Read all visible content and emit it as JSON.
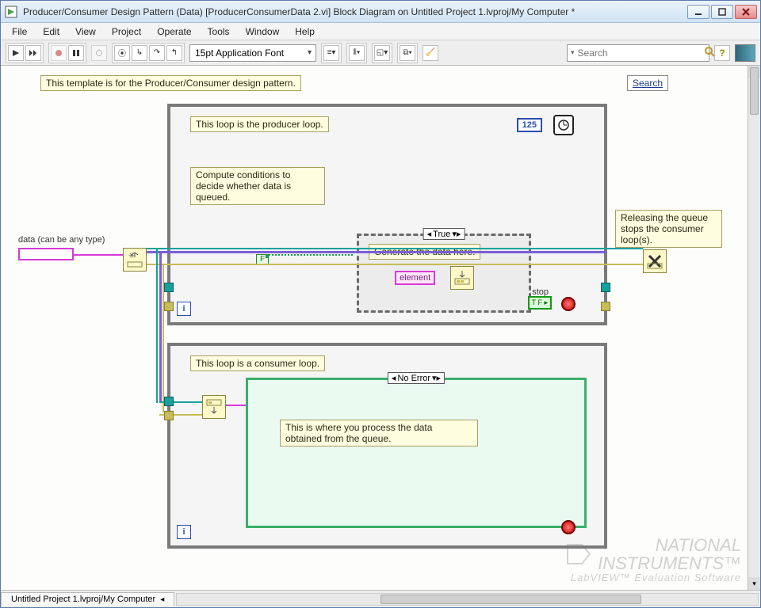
{
  "window": {
    "title": "Producer/Consumer Design Pattern (Data) [ProducerConsumerData 2.vi] Block Diagram on Untitled Project 1.lvproj/My Computer *"
  },
  "menu": [
    "File",
    "Edit",
    "View",
    "Project",
    "Operate",
    "Tools",
    "Window",
    "Help"
  ],
  "toolbar": {
    "font": "15pt Application Font",
    "search_placeholder": "Search"
  },
  "comments": {
    "template": "This template is for the Producer/Consumer design pattern.",
    "search_link": "Search",
    "producer_loop": "This loop is the producer loop.",
    "compute_cond": "Compute conditions to\ndecide whether data is\nqueued.",
    "generate": "Generate the data here.",
    "release": "Releasing the queue\nstops the consumer\nloop(s).",
    "consumer_loop": "This loop is a consumer loop.",
    "process": "This is where you process the data\nobtained from the queue."
  },
  "labels": {
    "data_any": "data (can be any type)",
    "element": "element",
    "stop": "stop",
    "case_true": "True",
    "case_noerr": "No Error"
  },
  "numbers": {
    "timer_ms": "125"
  },
  "footer": {
    "project_tab": "Untitled Project 1.lvproj/My Computer"
  },
  "watermark": {
    "line1": "NATIONAL",
    "line2": "INSTRUMENTS",
    "sub": "LabVIEW™ Evaluation Software"
  }
}
